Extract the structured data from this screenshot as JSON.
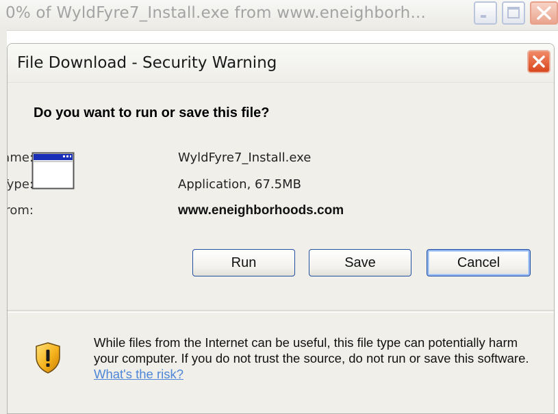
{
  "background_window": {
    "title": "0% of WyldFyre7_Install.exe from www.eneighborh..."
  },
  "dialog": {
    "title": "File Download - Security Warning",
    "question": "Do you want to run or save this file?",
    "file_info": {
      "name_label": "Name:",
      "name_value": "WyldFyre7_Install.exe",
      "type_label": "Type:",
      "type_value": "Application, 67.5MB",
      "from_label": "From:",
      "from_value": "www.eneighborhoods.com"
    },
    "buttons": {
      "run": "Run",
      "save": "Save",
      "cancel": "Cancel"
    },
    "warning": {
      "text": "While files from the Internet can be useful, this file type can potentially harm your computer. If you do not trust the source, do not run or save this software.",
      "link": "What's the risk?"
    }
  },
  "colors": {
    "title_bar_inactive_text": "#a3a3a3",
    "dialog_background": "#f0efea",
    "button_border": "#214fa0",
    "link": "#4d86d6",
    "close_button": "#d9471d"
  },
  "icons": [
    "minimize-icon",
    "maximize-icon",
    "close-icon",
    "application-icon",
    "shield-warning-icon"
  ]
}
